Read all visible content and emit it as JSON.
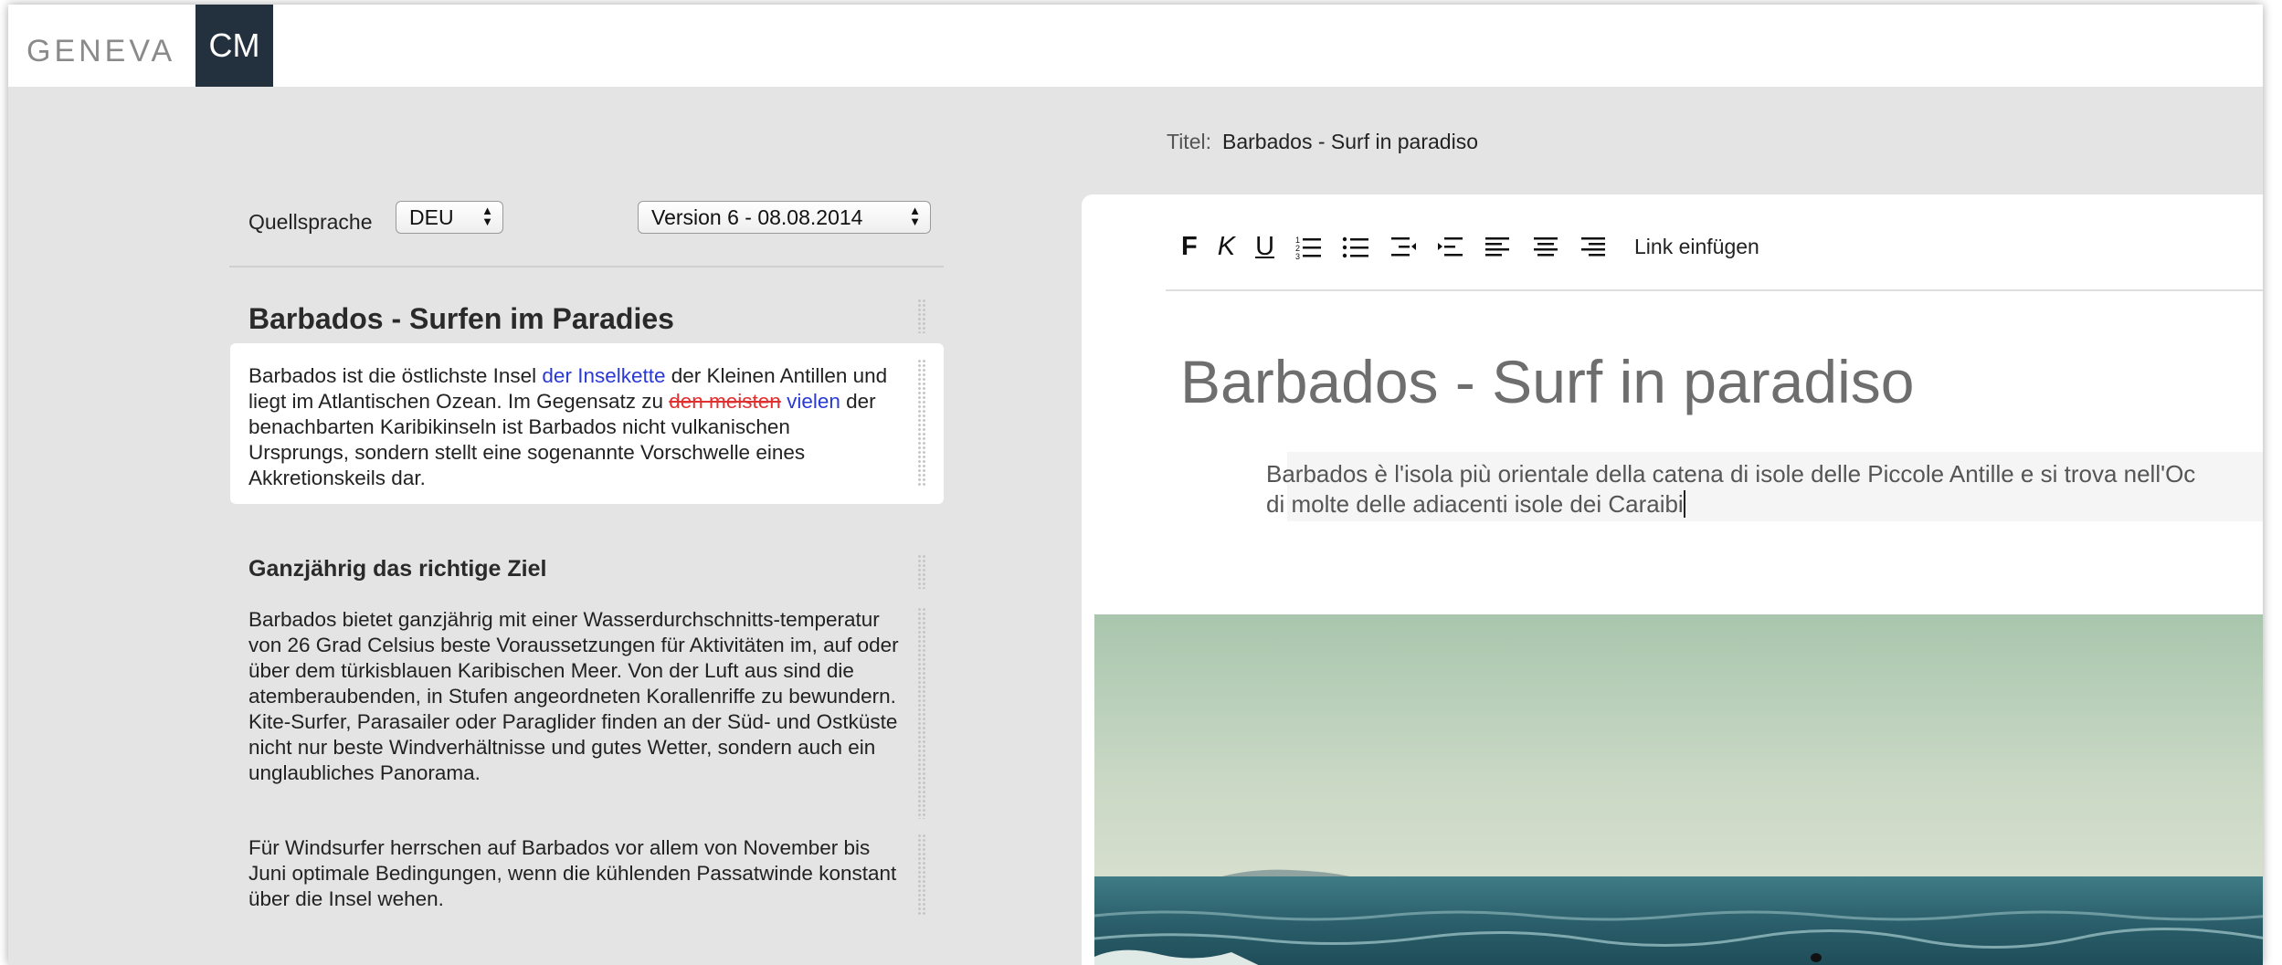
{
  "brand": {
    "geneva": "GENEVA",
    "cm": "CM"
  },
  "title_field": {
    "label": "Titel:",
    "value": "Barbados - Surf in paradiso"
  },
  "source": {
    "label": "Quellsprache",
    "language": "DEU",
    "version": "Version 6 - 08.08.2014",
    "heading": "Barbados - Surfen im Paradies",
    "para1": {
      "t1": "Barbados ist die östlichste Insel ",
      "ins1": "der Inselkette",
      "t2": " der Kleinen Antillen und liegt im Atlantischen Ozean. Im Gegensatz zu ",
      "del1": "den meisten",
      "ins2": "vielen",
      "t3": " der benachbarten Karibikinseln ist Barbados nicht vulkanischen Ursprungs, sondern stellt eine sogenannte Vorschwelle eines Akkretionskeils dar."
    },
    "heading2": "Ganzjährig das richtige Ziel",
    "para2": "Barbados bietet ganzjährig mit einer Wasserdurchschnitts-temperatur von 26 Grad Celsius beste Voraussetzungen für Aktivitäten im, auf oder über dem türkisblauen Karibischen Meer. Von der Luft aus sind die atemberaubenden, in Stufen angeordneten Korallenriffe zu bewundern. Kite-Surfer, Parasailer oder Paraglider finden an der Süd- und Ostküste nicht nur beste Windverhältnisse und gutes Wetter, sondern auch ein unglaubliches Panorama.",
    "para3": "Für Windsurfer herrschen auf Barbados vor allem von November bis Juni optimale Bedingungen, wenn die kühlenden Passatwinde konstant über die Insel wehen."
  },
  "toolbar": {
    "bold": "F",
    "italic": "K",
    "underline": "U",
    "link": "Link einfügen",
    "icons": [
      "ordered-list-icon",
      "bullet-list-icon",
      "outdent-icon",
      "indent-icon",
      "align-left-icon",
      "align-center-icon",
      "align-right-icon"
    ]
  },
  "editor": {
    "title": "Barbados - Surf in paradiso",
    "line1": "Barbados è l'isola più orientale della catena di isole delle Piccole Antille e si trova nell'Oc",
    "line2": "di molte delle adiacenti isole dei Caraibi"
  },
  "colors": {
    "accent_dark": "#23313f",
    "insert": "#2a39d6",
    "delete": "#e03030"
  }
}
